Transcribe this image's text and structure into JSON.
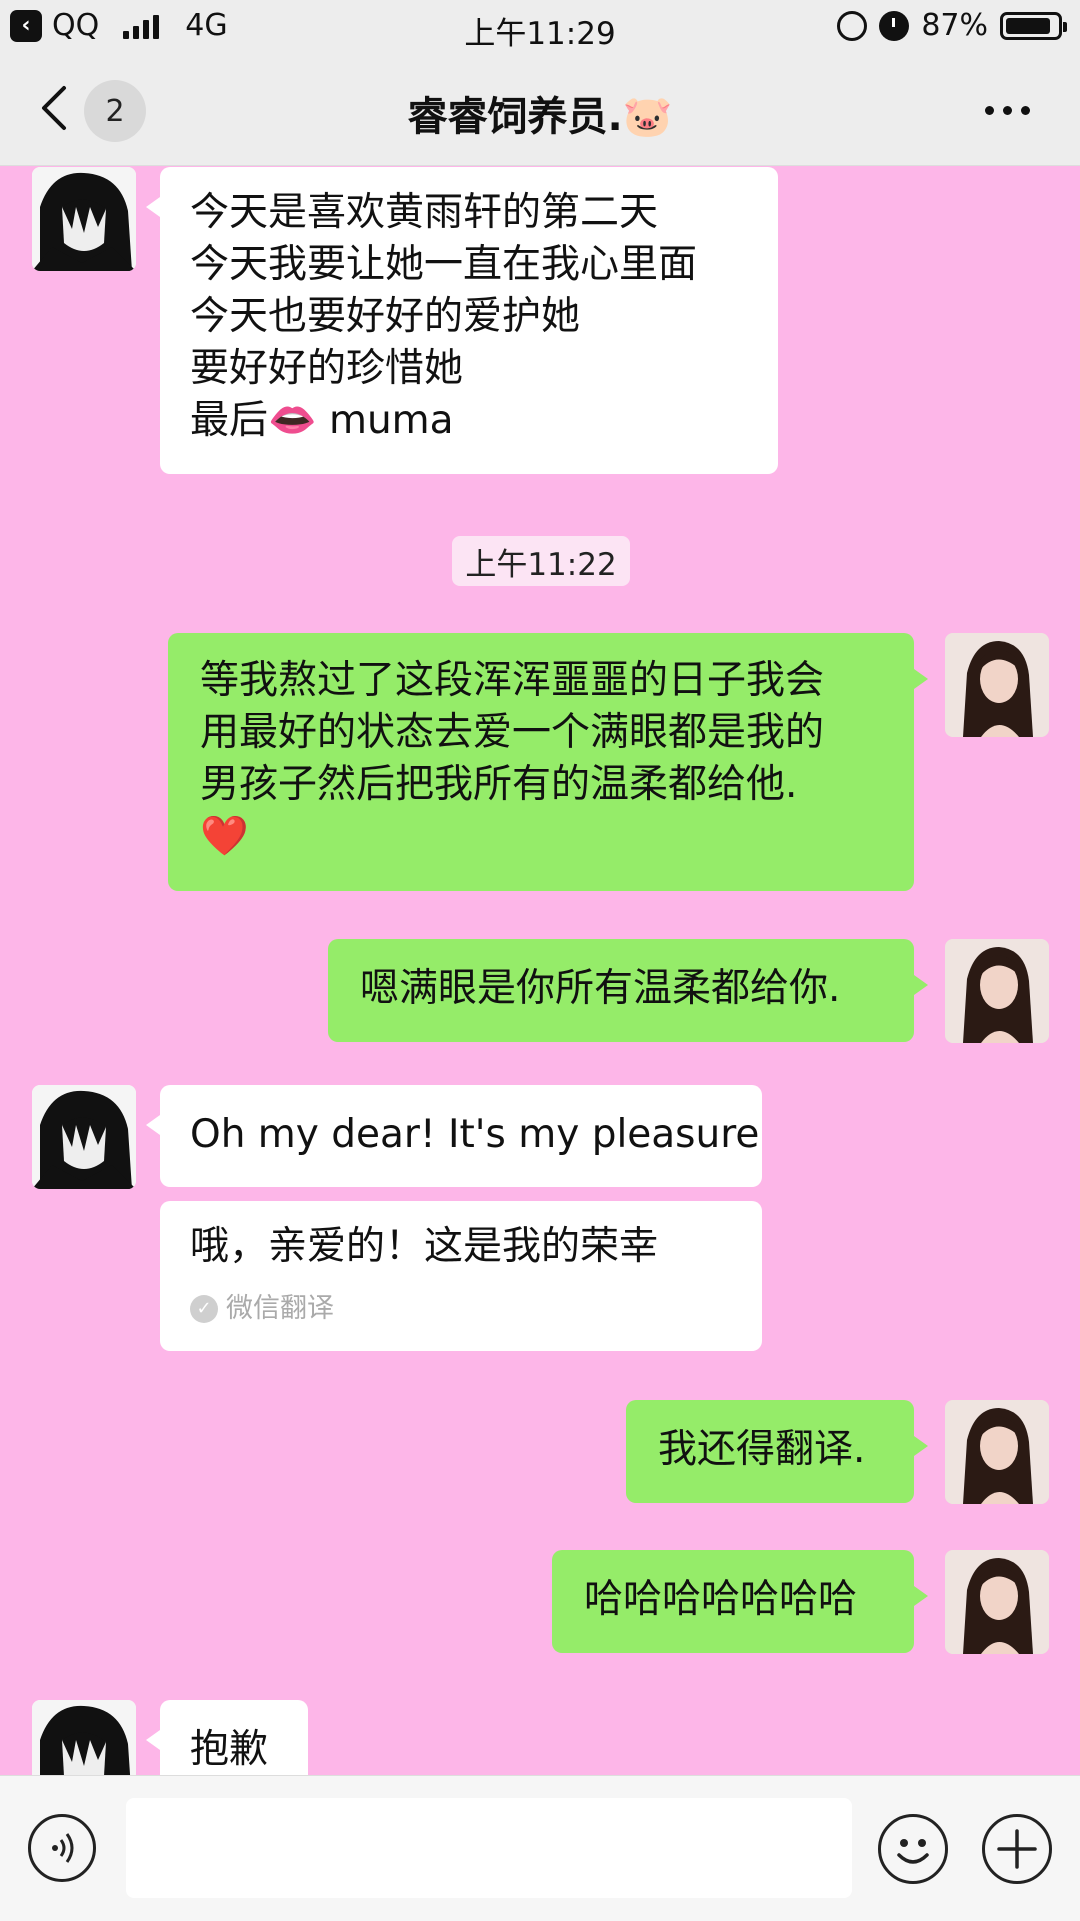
{
  "status_bar": {
    "app": "QQ",
    "network": "4G",
    "time": "上午11:29",
    "battery": "87%",
    "battery_level": 0.87
  },
  "nav": {
    "unread_count": "2",
    "title": "睿睿饲养员.🐷"
  },
  "chat": {
    "messages": [
      {
        "side": "left",
        "lines": [
          "今天是喜欢黄雨轩的第二天",
          "今天我要让她一直在我心里面",
          "今天也要好好的爱护她",
          "要好好的珍惜她",
          "最后👄 muma"
        ]
      },
      {
        "type": "timestamp",
        "text": "上午11:22"
      },
      {
        "side": "right",
        "lines": [
          "等我熬过了这段浑浑噩噩的日子我会",
          "用最好的状态去爱一个满眼都是我的",
          "男孩子然后把我所有的温柔都给他.",
          "❤️"
        ]
      },
      {
        "side": "right",
        "lines": [
          "嗯满眼是你所有温柔都给你."
        ]
      },
      {
        "side": "left",
        "lines": [
          "Oh my dear! It's my pleasure"
        ]
      },
      {
        "side": "left",
        "type": "translation",
        "lines": [
          "哦，亲爱的！这是我的荣幸"
        ],
        "label": "微信翻译"
      },
      {
        "side": "right",
        "lines": [
          "我还得翻译."
        ]
      },
      {
        "side": "right",
        "lines": [
          "哈哈哈哈哈哈哈"
        ]
      },
      {
        "side": "left",
        "lines": [
          "抱歉"
        ]
      }
    ]
  },
  "colors": {
    "chat_background": "#fdb6e8",
    "sent_bubble": "#95ec69",
    "received_bubble": "#ffffff",
    "bar_background": "#ededed"
  },
  "icons": {
    "voice": "voice-icon",
    "emoji": "emoji-icon",
    "more": "plus-icon"
  }
}
